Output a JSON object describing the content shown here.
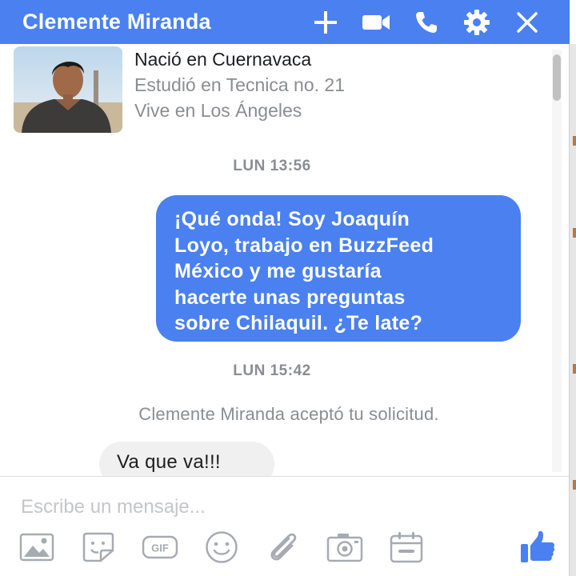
{
  "header": {
    "contact_name": "Clemente Miranda",
    "background": "#4a80f0",
    "actions": [
      "add-people-icon",
      "video-call-icon",
      "voice-call-icon",
      "settings-gear-icon",
      "close-icon"
    ]
  },
  "profile": {
    "details": [
      "Nació en Cuernavaca",
      "Estudió en Tecnica no. 21",
      "Vive en Los Ángeles"
    ]
  },
  "conversation": {
    "timestamp_1": "LUN 13:56",
    "outgoing_message": [
      "¡Qué onda! Soy Joaquín",
      "Loyo, trabajo en BuzzFeed",
      "México y me gustaría",
      "hacerte unas preguntas",
      "sobre Chilaquil. ¿Te late?"
    ],
    "timestamp_2": "LUN 15:42",
    "system_note": "Clemente Miranda aceptó tu solicitud.",
    "incoming_message": "Va que va!!!"
  },
  "composer": {
    "placeholder": "Escribe un mensaje...",
    "value": "",
    "tools": [
      "photo-icon",
      "sticker-icon",
      "gif-icon",
      "emoji-icon",
      "attachment-icon",
      "camera-icon",
      "calendar-icon"
    ],
    "send": "like-thumb-icon"
  },
  "colors": {
    "accent": "#4a80f0",
    "incoming_bubble": "#f1f0f0",
    "meta_text": "#8a8d91"
  }
}
